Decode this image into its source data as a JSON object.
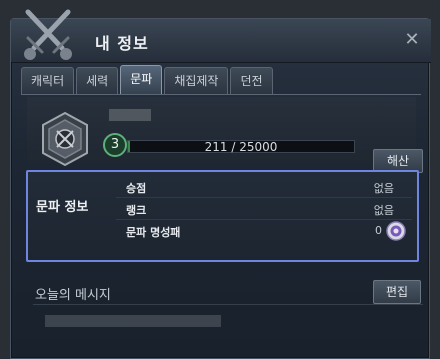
{
  "window": {
    "title": "내 정보",
    "close_label": "✕"
  },
  "tabs": [
    {
      "label": "캐릭터",
      "active": false
    },
    {
      "label": "세력",
      "active": false
    },
    {
      "label": "문파",
      "active": true
    },
    {
      "label": "채집제작",
      "active": false
    },
    {
      "label": "던전",
      "active": false
    }
  ],
  "clan": {
    "name": "■■■■",
    "level": "3",
    "exp_text": "211 / 25000",
    "exp_fraction": 0.0084,
    "disband_label": "해산"
  },
  "clan_info": {
    "label": "문파 정보",
    "rows": [
      {
        "key": "승점",
        "value": "없음"
      },
      {
        "key": "랭크",
        "value": "없음"
      },
      {
        "key": "문파 명성패",
        "value": "0"
      }
    ]
  },
  "message": {
    "title": "오늘의 메시지",
    "edit_label": "편집",
    "text": "■■■■■■■■■■■■■■■■■■"
  },
  "colors": {
    "info_border": "#6f86e0",
    "exp_fill": "#3e8a4e"
  }
}
